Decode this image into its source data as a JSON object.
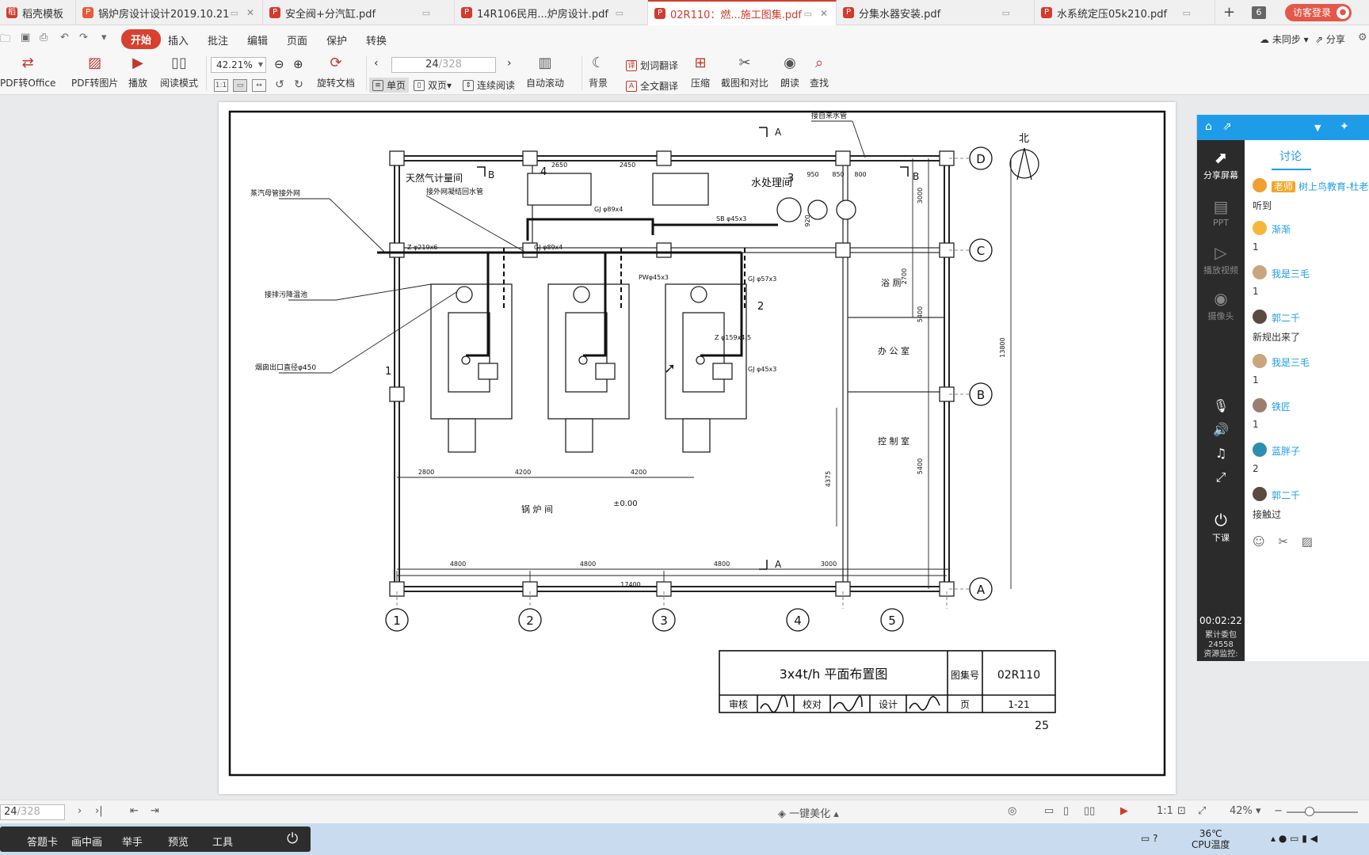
{
  "tabs": [
    {
      "label": "稻壳模板",
      "icon": "docer-icon",
      "active": false
    },
    {
      "label": "锅炉房设计设计2019.10.21",
      "icon": "wps-doc-icon",
      "active": false
    },
    {
      "label": "安全阀+分汽缸.pdf",
      "icon": "pdf-icon",
      "active": false
    },
    {
      "label": "14R106民用...炉房设计.pdf",
      "icon": "pdf-icon",
      "active": false
    },
    {
      "label": "02R110：燃...施工图集.pdf",
      "icon": "pdf-icon",
      "active": true
    },
    {
      "label": "分集水器安装.pdf",
      "icon": "pdf-icon",
      "active": false
    },
    {
      "label": "水系统定压05k210.pdf",
      "icon": "pdf-icon",
      "active": false
    }
  ],
  "tab_count": "6",
  "visitor_label": "访客登录",
  "menu": {
    "start": "开始",
    "items": [
      "插入",
      "批注",
      "编辑",
      "页面",
      "保护",
      "转换"
    ],
    "sync": "未同步",
    "share": "分享"
  },
  "toolbar": {
    "pdf_to_office": "PDF转Office",
    "pdf_to_image": "PDF转图片",
    "play": "播放",
    "read_mode": "阅读模式",
    "zoom": "42.21%",
    "rotate_doc": "旋转文档",
    "page_current": "24",
    "page_total": "/328",
    "single_page": "单页",
    "double_page": "双页",
    "continuous": "连续阅读",
    "auto_scroll": "自动滚动",
    "background": "背景",
    "word_translate": "划词翻译",
    "full_translate": "全文翻译",
    "compress": "压缩",
    "screenshot_compare": "截图和对比",
    "read_aloud": "朗读",
    "find": "查找"
  },
  "drawing": {
    "rooms": {
      "gas_meter": "天然气计量间",
      "water_treatment": "水处理间",
      "bathroom": "浴 厕",
      "office": "办 公 室",
      "control": "控 制 室",
      "boiler_room": "锅 炉 间"
    },
    "leaders": {
      "steam_pipe": "蒸汽母管接外网",
      "return_pipe": "接外网凝结回水管",
      "drain_pool": "接排污降温池",
      "flue": "烟囱出口直径φ450",
      "city_water": "接自来水管"
    },
    "pipe_labels": {
      "z219": "Z φ219x6",
      "gj89a": "GJ φ89x4",
      "gj89b": "GJ φ89x4",
      "sb45": "SB φ45x3",
      "pw45": "PWφ45x3",
      "gj57": "GJ φ57x3",
      "z159": "Z φ159x4.5",
      "gj45": "GJ φ45x3"
    },
    "dims": {
      "d2650": "2650",
      "d2450": "2450",
      "d950": "950",
      "d850": "850",
      "d800": "800",
      "d2800": "2800",
      "d4200a": "4200",
      "d4200b": "4200",
      "d4800a": "4800",
      "d4800b": "4800",
      "d4800c": "4800",
      "d3000": "3000",
      "d17400": "17400",
      "v3000": "3000",
      "v2700": "2700",
      "v5400a": "5400",
      "v5400b": "5400",
      "v13800": "13800",
      "v4375": "4375",
      "v920": "920"
    },
    "axes_h": [
      "1",
      "2",
      "3",
      "4",
      "5"
    ],
    "axes_v": [
      "D",
      "C",
      "B",
      "A"
    ],
    "section_a": "A",
    "section_b": "B",
    "elevation": "±0.00",
    "north": "北",
    "callouts": [
      "1",
      "2",
      "3",
      "4"
    ],
    "title_block": {
      "title": "3x4t/h 平面布置图",
      "atlas_label": "图集号",
      "atlas_no": "02R110",
      "review": "审核",
      "check": "校对",
      "design": "设计",
      "page_label": "页",
      "page_no": "1-21"
    },
    "page_number": "25"
  },
  "panel": {
    "tab_discuss": "讨论",
    "side": [
      {
        "label": "分享屏幕",
        "icon": "share-screen-icon",
        "on": true
      },
      {
        "label": "PPT",
        "icon": "ppt-icon",
        "on": false
      },
      {
        "label": "播放视频",
        "icon": "play-video-icon",
        "on": false
      },
      {
        "label": "摄像头",
        "icon": "camera-icon",
        "on": false
      },
      {
        "label": "下课",
        "icon": "end-class-icon",
        "on": true
      }
    ],
    "timer": "00:02:22",
    "accumulated": "累计委包",
    "acc_value": "24558",
    "resource": "资源监控:",
    "messages": [
      {
        "name": "树上鸟教育-杜老",
        "tag": "老师",
        "text": "听到",
        "color": "#f0a030"
      },
      {
        "name": "渐渐",
        "tag": "",
        "text": "1",
        "color": "#f5b73b"
      },
      {
        "name": "我是三毛",
        "tag": "",
        "text": "1",
        "color": "#c9a57e"
      },
      {
        "name": "郭二千",
        "tag": "",
        "text": "新规出来了",
        "color": "#5a4a42"
      },
      {
        "name": "我是三毛",
        "tag": "",
        "text": "1",
        "color": "#c9a57e"
      },
      {
        "name": "铁匠",
        "tag": "",
        "text": "1",
        "color": "#9a7f70"
      },
      {
        "name": "蓝胖子",
        "tag": "",
        "text": "2",
        "color": "#2d8fb0"
      },
      {
        "name": "郭二千",
        "tag": "",
        "text": "接触过",
        "color": "#5a4a42"
      }
    ]
  },
  "status": {
    "page_current": "24",
    "page_total": "/328",
    "beautify": "一键美化",
    "zoom": "42%"
  },
  "taskbar": {
    "items": [
      "答题卡",
      "画中画",
      "举手",
      "预览",
      "工具"
    ],
    "temp": "36℃",
    "temp_label": "CPU温度"
  }
}
